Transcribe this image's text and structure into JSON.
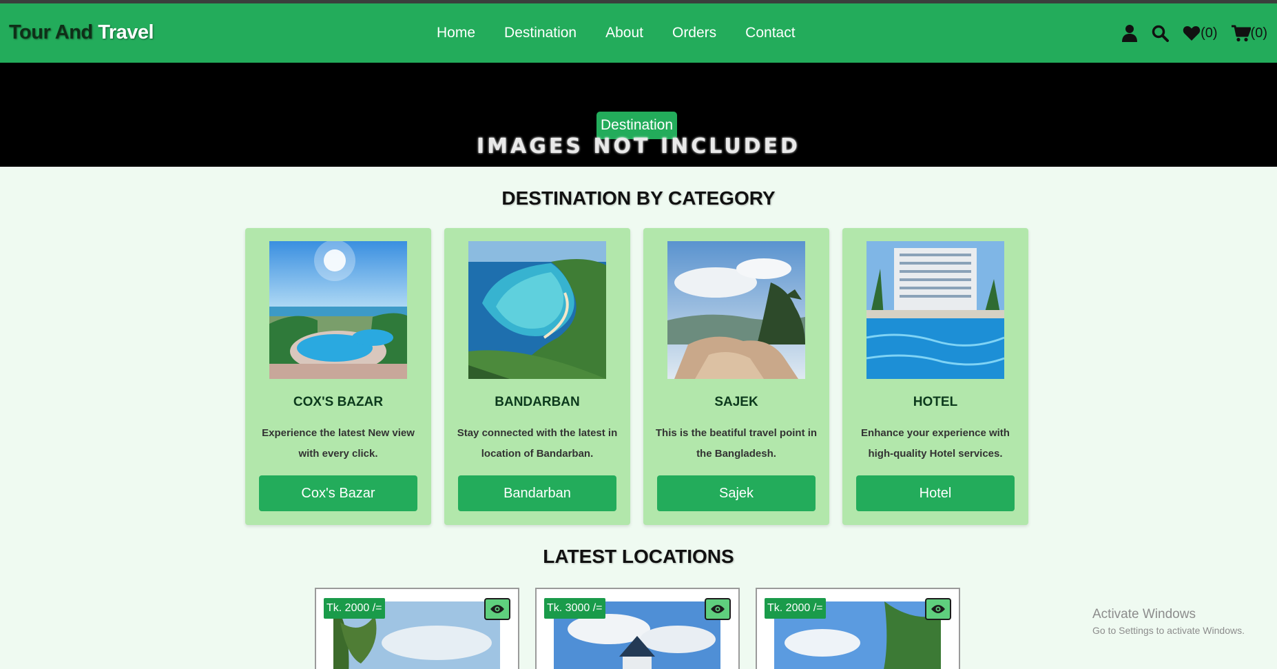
{
  "header": {
    "logo_part1": "Tour And",
    "logo_part2": "Travel",
    "nav": [
      {
        "label": "Home"
      },
      {
        "label": "Destination"
      },
      {
        "label": "About"
      },
      {
        "label": "Orders"
      },
      {
        "label": "Contact"
      }
    ],
    "icons": {
      "user": "user-icon",
      "search": "search-icon",
      "wishlist": "heart-icon",
      "wishlist_count": "(0)",
      "cart": "cart-icon",
      "cart_count": "(0)"
    }
  },
  "banner": {
    "pill": "Destination",
    "placeholder_text": "IMAGES NOT INCLUDED"
  },
  "categories": {
    "title": "DESTINATION BY CATEGORY",
    "items": [
      {
        "name": "COX'S BAZAR",
        "desc": "Experience the latest New view with every click.",
        "button": "Cox's Bazar"
      },
      {
        "name": "BANDARBAN",
        "desc": "Stay connected with the latest in location of Bandarban.",
        "button": "Bandarban"
      },
      {
        "name": "SAJEK",
        "desc": "This is the beatiful travel point in the Bangladesh.",
        "button": "Sajek"
      },
      {
        "name": "HOTEL",
        "desc": "Enhance your experience with high-quality Hotel services.",
        "button": "Hotel"
      }
    ]
  },
  "latest": {
    "title": "LATEST LOCATIONS",
    "items": [
      {
        "price": "Tk. 2000 /="
      },
      {
        "price": "Tk. 3000 /="
      },
      {
        "price": "Tk. 2000 /="
      }
    ]
  },
  "watermark": {
    "line1": "Activate Windows",
    "line2": "Go to Settings to activate Windows."
  },
  "colors": {
    "accent": "#23ac5b",
    "card_bg": "#b2e7ab",
    "page_bg": "#effaf1"
  }
}
